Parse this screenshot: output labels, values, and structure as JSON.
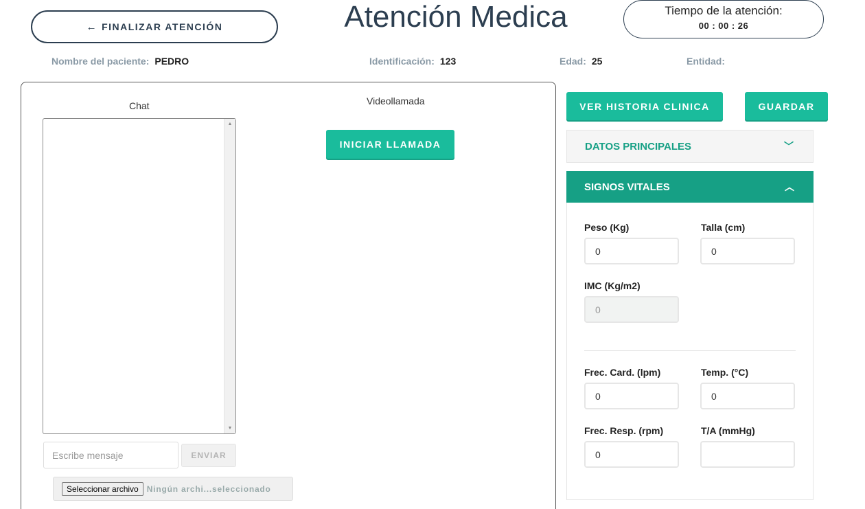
{
  "header": {
    "back_button": "FINALIZAR ATENCIÓN",
    "back_arrow": "🡐",
    "title": "Atención Medica",
    "timer_label": "Tiempo de la atención:",
    "timer_value": "00 : 00 : 26"
  },
  "patient": {
    "name_label": "Nombre del paciente:",
    "name": "PEDRO",
    "id_label": "Identificación:",
    "id": "123",
    "age_label": "Edad:",
    "age": "25",
    "entity_label": "Entidad:",
    "entity": ""
  },
  "chat": {
    "title": "Chat",
    "placeholder": "Escribe mensaje",
    "send_label": "ENVIAR",
    "file_button": "Seleccionar archivo",
    "file_status": "Ningún archi...seleccionado"
  },
  "video": {
    "title": "Videollamada",
    "call_button": "INICIAR LLAMADA"
  },
  "actions": {
    "history_button": "VER HISTORIA CLINICA",
    "save_button": "GUARDAR"
  },
  "accordion": {
    "main_data": "DATOS PRINCIPALES",
    "main_data_chevron": "﹀",
    "vitals": "SIGNOS VITALES",
    "vitals_chevron": "︿"
  },
  "vitals": {
    "weight_label": "Peso (Kg)",
    "weight": "0",
    "height_label": "Talla (cm)",
    "height": "0",
    "bmi_label": "IMC (Kg/m2)",
    "bmi": "0",
    "heart_rate_label": "Frec. Card. (lpm)",
    "heart_rate": "0",
    "temp_label": "Temp. (°C)",
    "temp": "0",
    "resp_rate_label": "Frec. Resp. (rpm)",
    "resp_rate": "0",
    "bp_label": "T/A (mmHg)",
    "bp": ""
  },
  "colors": {
    "teal": "#1abc9c",
    "teal_dark": "#16a085",
    "navy": "#2c3e50"
  }
}
